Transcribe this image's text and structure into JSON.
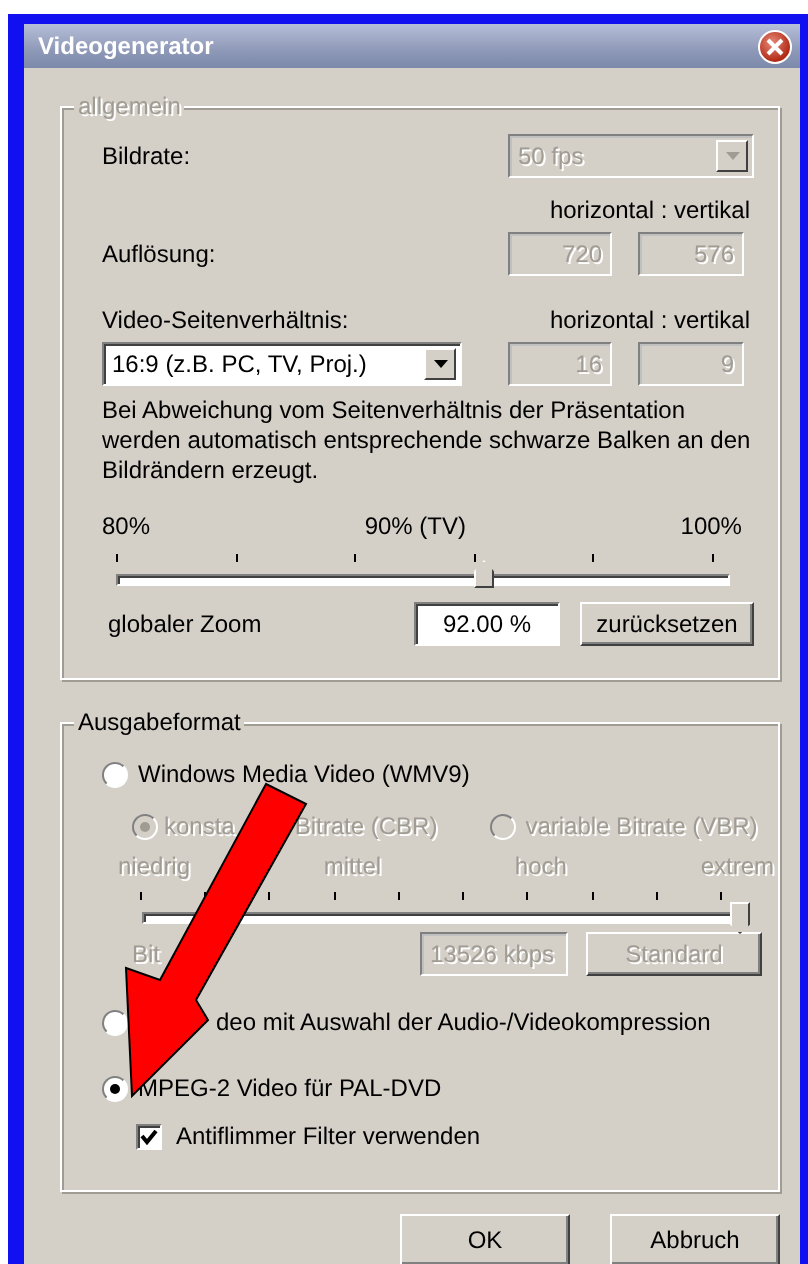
{
  "window": {
    "title": "Videogenerator"
  },
  "general": {
    "legend": "allgemein",
    "legend_disabled": true,
    "frame_rate": {
      "label": "Bildrate:",
      "value": "50 fps",
      "disabled": true
    },
    "resolution": {
      "header": "horizontal : vertikal",
      "label": "Auflösung:",
      "horizontal": "720",
      "vertical": "576",
      "disabled": true
    },
    "aspect": {
      "label": "Video-Seitenverhältnis:",
      "header": "horizontal : vertikal",
      "value": "16:9 (z.B. PC, TV, Proj.)",
      "horizontal": "16",
      "vertical": "9",
      "disabled": true
    },
    "note": "Bei Abweichung vom Seitenverhältnis der Präsentation werden automatisch entsprechende schwarze Balken an den Bildrändern erzeugt.",
    "zoom": {
      "scale_labels": [
        "80%",
        "90% (TV)",
        "100%"
      ],
      "level": 0.6,
      "label": "globaler Zoom",
      "value": "92.00 %",
      "reset_button": "zurücksetzen"
    }
  },
  "output": {
    "legend": "Ausgabeformat",
    "wmv": {
      "label": "Windows Media Video (WMV9)",
      "selected": false,
      "disabled": true,
      "bitrate_modes": [
        {
          "label": "konsta",
          "label_after": "Bitrate (CBR)",
          "selected": true
        },
        {
          "label": "variable Bitrate (VBR)",
          "selected": false
        }
      ],
      "quality_labels": [
        "niedrig",
        "mittel",
        "hoch",
        "extrem"
      ],
      "level": 1.0,
      "bitrate_label": "Bit",
      "bitrate": "13526 kbps",
      "default_button": "Standard"
    },
    "custom": {
      "label": "deo mit Auswahl der Audio-/Videokompression",
      "selected": false
    },
    "mpeg2": {
      "label": "MPEG-2 Video für PAL-DVD",
      "selected": true,
      "antiflicker": {
        "label": "Antiflimmer Filter verwenden",
        "checked": true
      }
    }
  },
  "buttons": [
    {
      "label": "OK"
    },
    {
      "label": "Abbruch"
    }
  ]
}
